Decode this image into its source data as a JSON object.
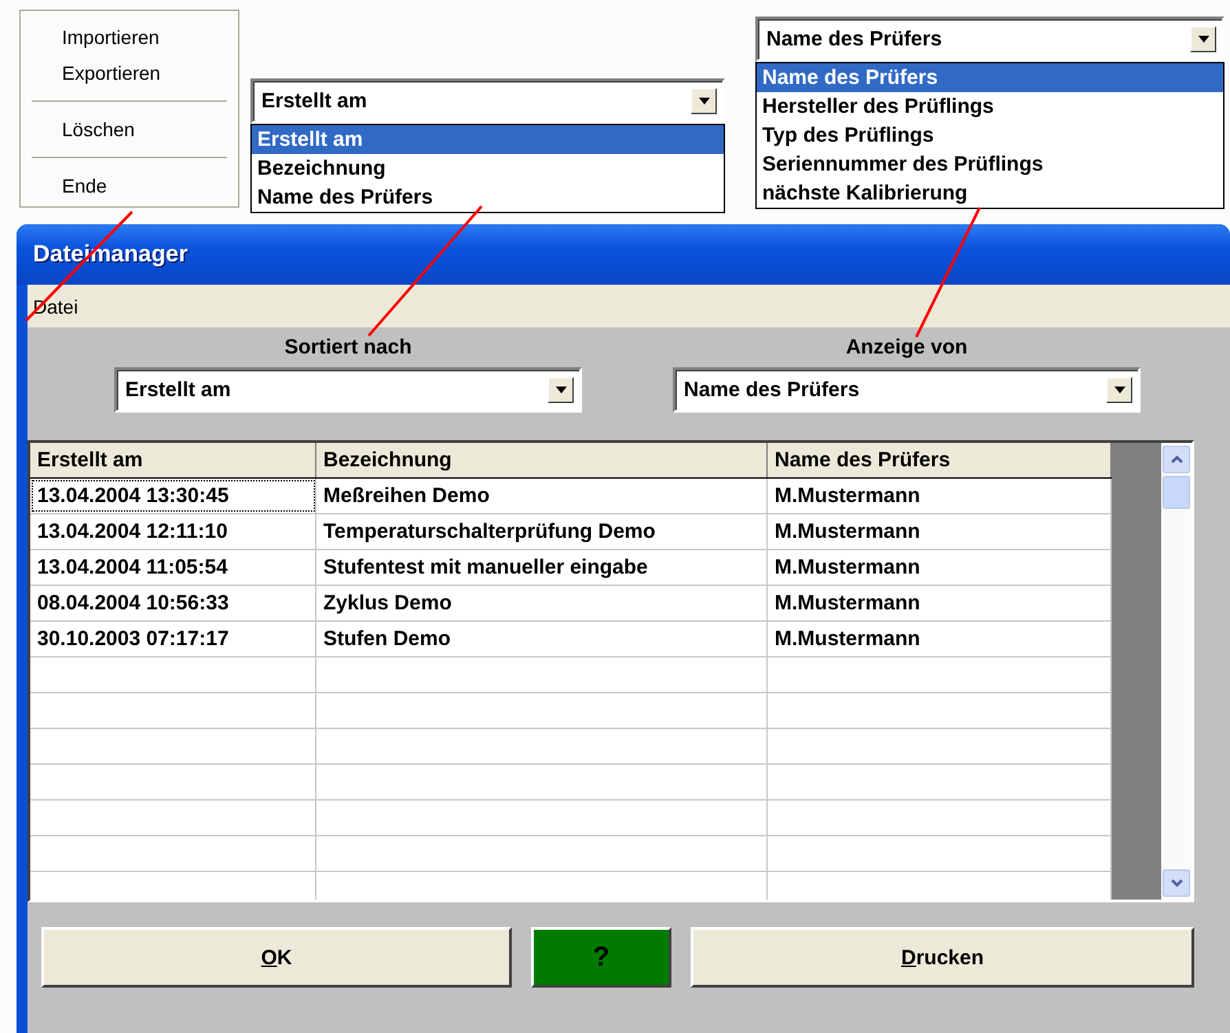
{
  "popup_menu": {
    "items": [
      {
        "kind": "item",
        "label": "Importieren"
      },
      {
        "kind": "item",
        "label": "Exportieren"
      },
      {
        "kind": "separator"
      },
      {
        "kind": "item",
        "label": "Löschen"
      },
      {
        "kind": "separator"
      },
      {
        "kind": "item",
        "label": "Ende"
      }
    ]
  },
  "sort_dropdown_open": {
    "value": "Erstellt am",
    "options": [
      {
        "label": "Erstellt am",
        "selected": true
      },
      {
        "label": "Bezeichnung",
        "selected": false
      },
      {
        "label": "Name des Prüfers",
        "selected": false
      }
    ]
  },
  "display_dropdown_open": {
    "value": "Name des Prüfers",
    "options": [
      {
        "label": "Name des Prüfers",
        "selected": true
      },
      {
        "label": "Hersteller des Prüflings",
        "selected": false
      },
      {
        "label": "Typ des Prüflings",
        "selected": false
      },
      {
        "label": "Seriennummer des Prüflings",
        "selected": false
      },
      {
        "label": "nächste Kalibrierung",
        "selected": false
      }
    ]
  },
  "window": {
    "title": "Dateimanager",
    "menu": [
      "Datei"
    ],
    "sort_label": "Sortiert nach",
    "sort_value": "Erstellt am",
    "display_label": "Anzeige von",
    "display_value": "Name des Prüfers"
  },
  "table": {
    "columns": [
      "Erstellt am",
      "Bezeichnung",
      "Name des Prüfers"
    ],
    "rows": [
      {
        "cells": [
          "13.04.2004 13:30:45",
          "Meßreihen Demo",
          "M.Mustermann"
        ],
        "focused": true
      },
      {
        "cells": [
          "13.04.2004 12:11:10",
          "Temperaturschalterprüfung Demo",
          "M.Mustermann"
        ],
        "focused": false
      },
      {
        "cells": [
          "13.04.2004 11:05:54",
          "Stufentest mit manueller eingabe",
          "M.Mustermann"
        ],
        "focused": false
      },
      {
        "cells": [
          "08.04.2004 10:56:33",
          "Zyklus Demo",
          "M.Mustermann"
        ],
        "focused": false
      },
      {
        "cells": [
          "30.10.2003 07:17:17",
          "Stufen Demo",
          "M.Mustermann"
        ],
        "focused": false
      }
    ]
  },
  "buttons": [
    {
      "label": "OK",
      "kind": "normal"
    },
    {
      "label": "?",
      "kind": "help"
    },
    {
      "label": "Drucken",
      "kind": "normal"
    }
  ]
}
